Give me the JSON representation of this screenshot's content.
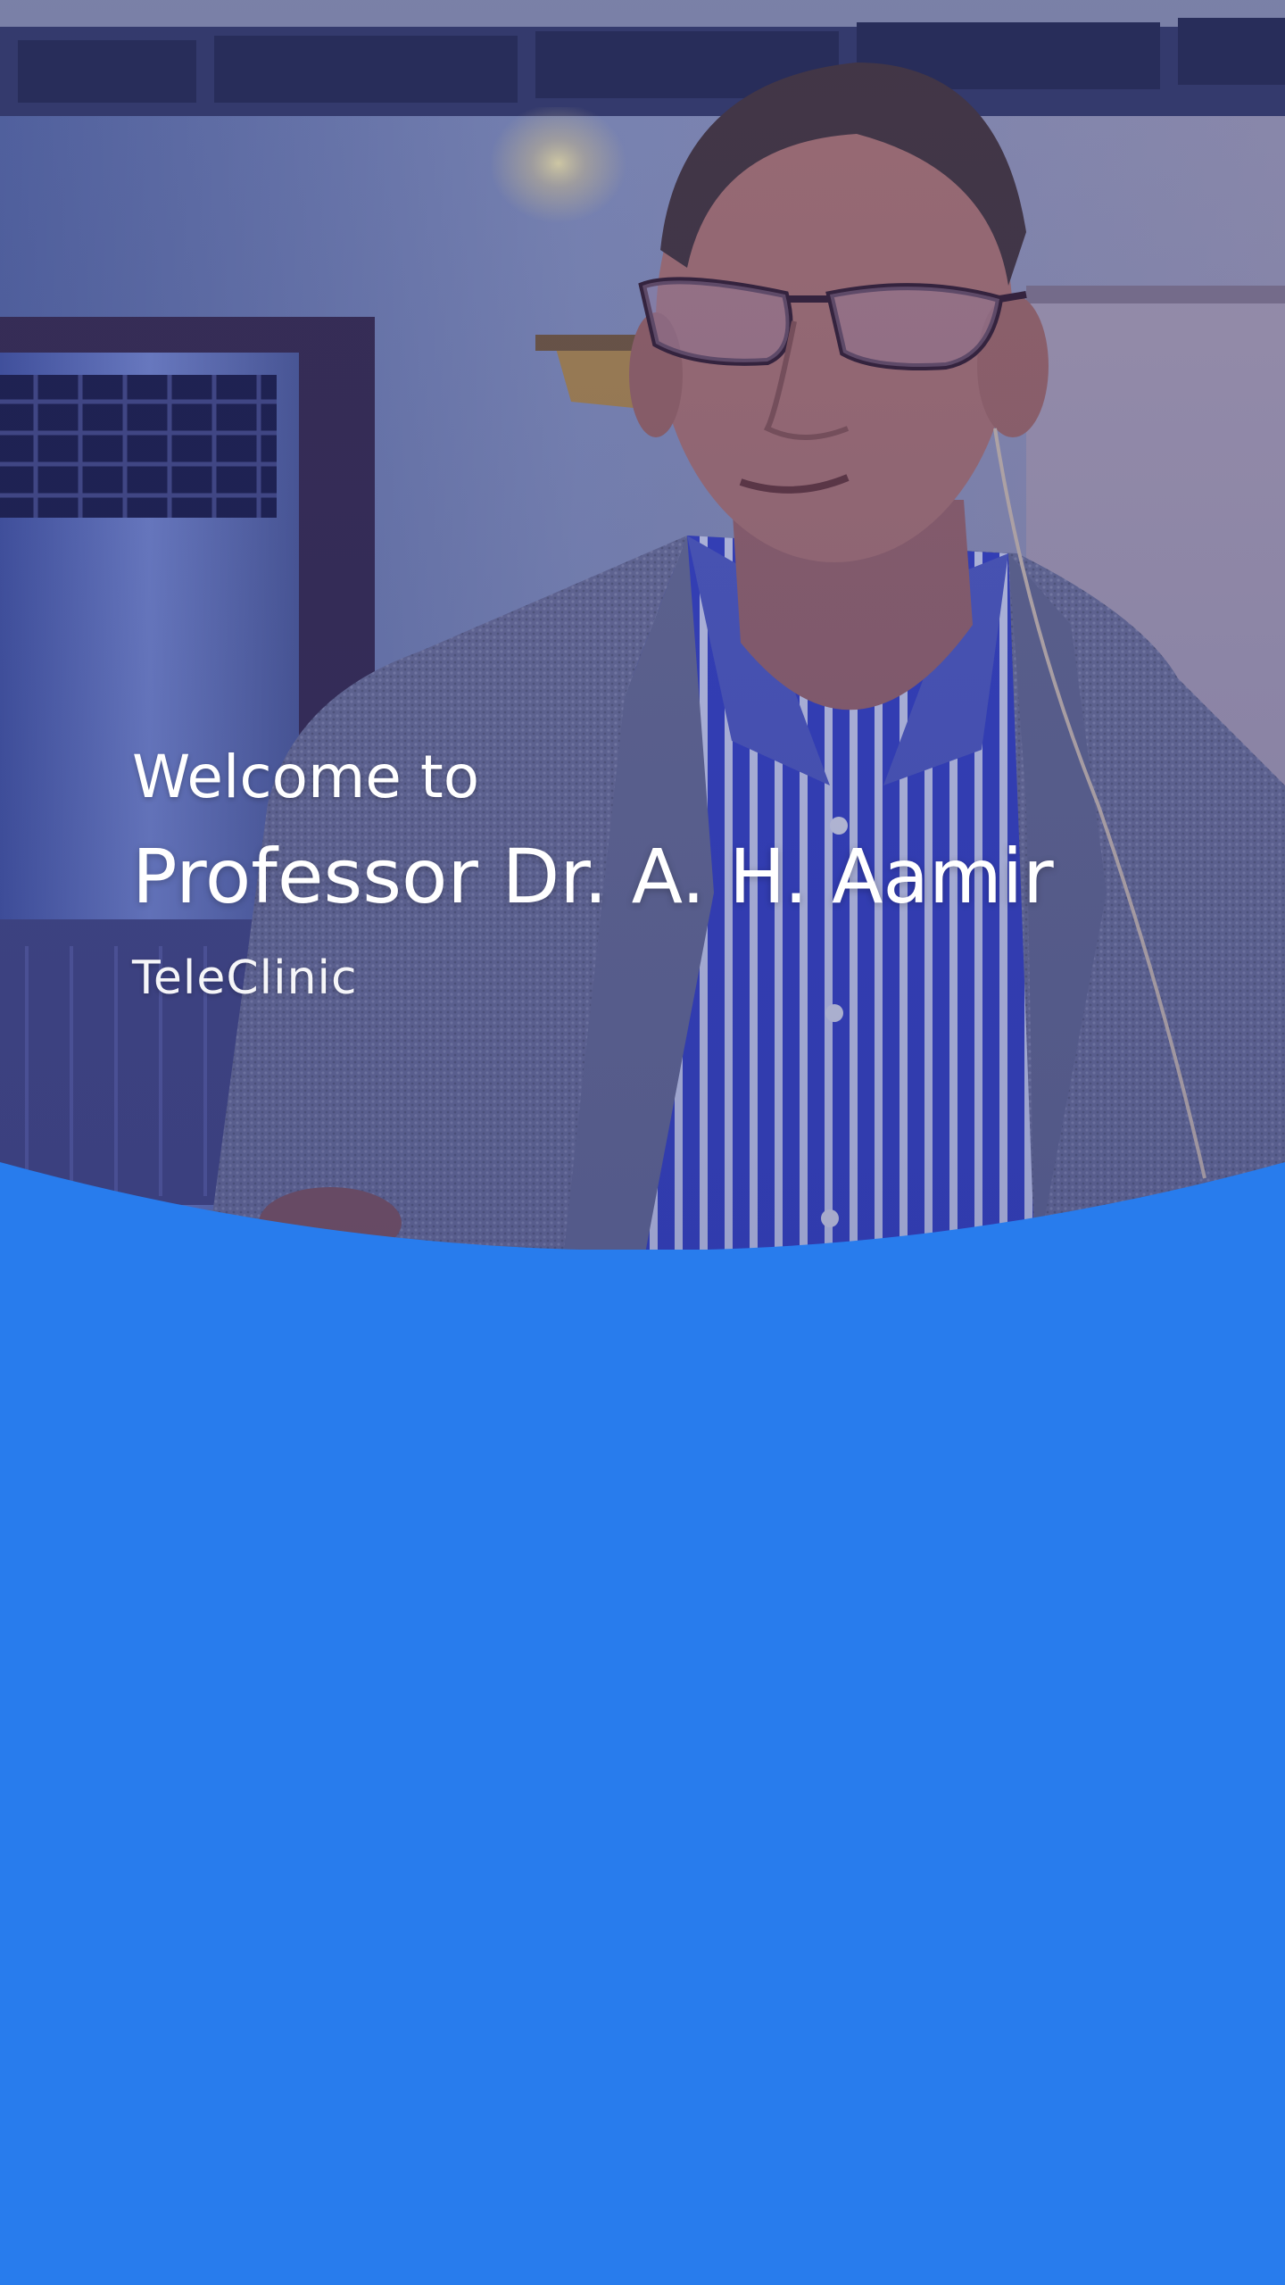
{
  "welcome": {
    "greeting": "Welcome to",
    "doctor_name": "Professor Dr. A. H. Aamir",
    "clinic_name": "TeleClinic"
  },
  "hero": {
    "image": "doctor-portrait-photo"
  },
  "colors": {
    "primary_blue": "#287ced",
    "overlay_tint": "#1b2a8a",
    "text": "#ffffff"
  }
}
